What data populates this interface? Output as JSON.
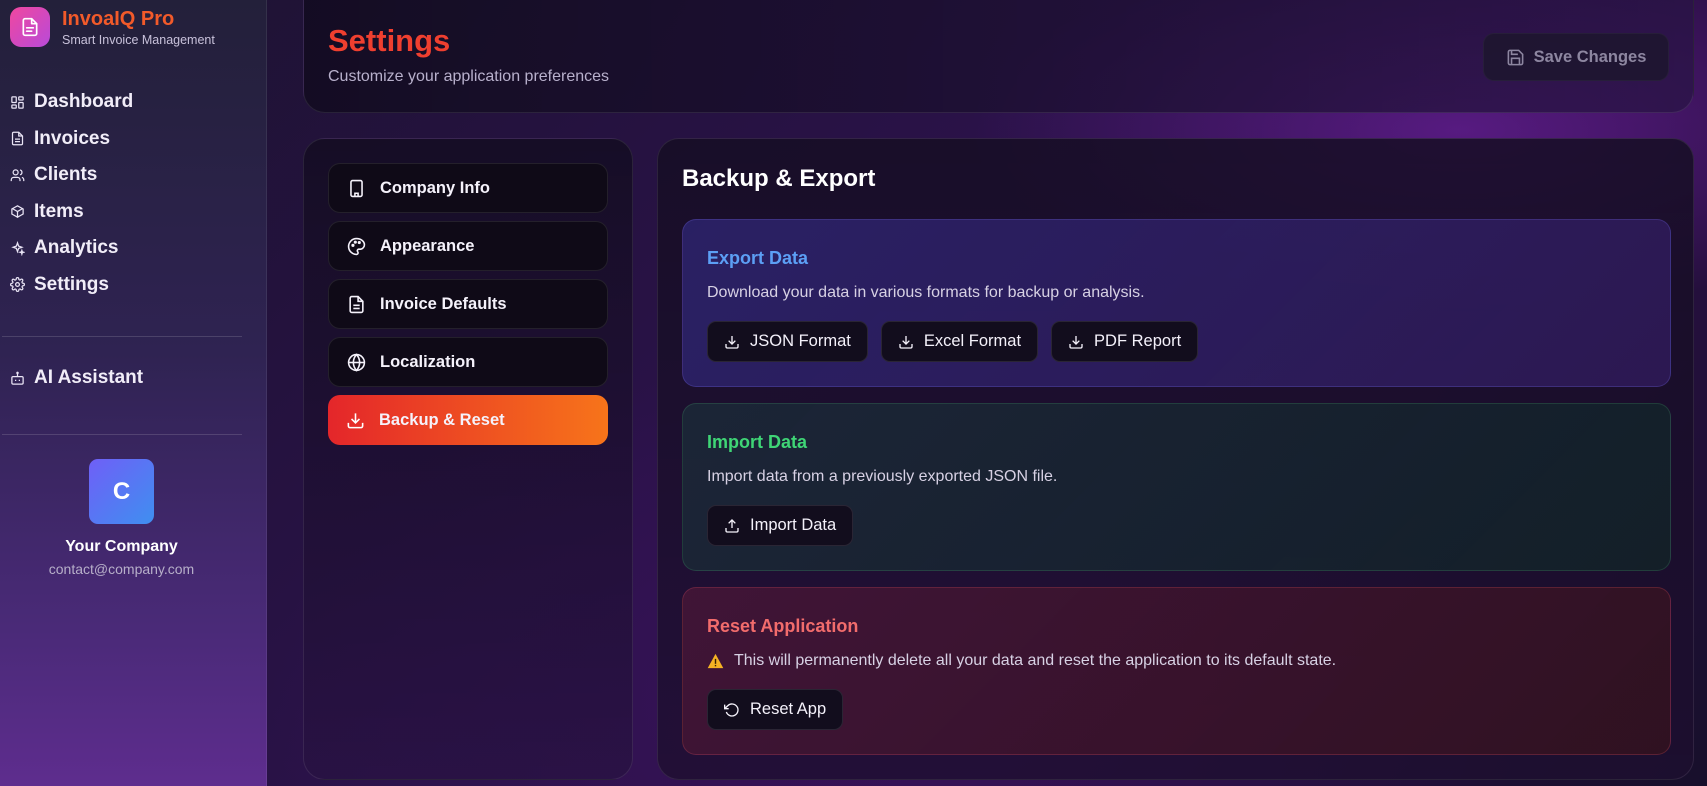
{
  "brand": {
    "title": "InvoaIQ Pro",
    "subtitle": "Smart Invoice Management"
  },
  "nav": {
    "items": [
      {
        "label": "Dashboard",
        "icon": "grid-icon"
      },
      {
        "label": "Invoices",
        "icon": "file-icon"
      },
      {
        "label": "Clients",
        "icon": "users-icon"
      },
      {
        "label": "Items",
        "icon": "box-icon"
      },
      {
        "label": "Analytics",
        "icon": "sparkles-icon"
      },
      {
        "label": "Settings",
        "icon": "gear-icon"
      }
    ],
    "assistant_label": "AI Assistant"
  },
  "profile": {
    "avatar_letter": "C",
    "name": "Your Company",
    "email": "contact@company.com"
  },
  "header": {
    "title": "Settings",
    "subtitle": "Customize your application preferences",
    "save_label": "Save Changes"
  },
  "tabs": [
    {
      "label": "Company Info",
      "icon": "building-icon"
    },
    {
      "label": "Appearance",
      "icon": "palette-icon"
    },
    {
      "label": "Invoice Defaults",
      "icon": "document-icon"
    },
    {
      "label": "Localization",
      "icon": "globe-icon"
    },
    {
      "label": "Backup & Reset",
      "icon": "download-icon",
      "active": true
    }
  ],
  "content": {
    "title": "Backup & Export",
    "export": {
      "title": "Export Data",
      "description": "Download your data in various formats for backup or analysis.",
      "buttons": [
        "JSON Format",
        "Excel Format",
        "PDF Report"
      ]
    },
    "import": {
      "title": "Import Data",
      "description": "Import data from a previously exported JSON file.",
      "button": "Import Data"
    },
    "reset": {
      "title": "Reset Application",
      "description": "This will permanently delete all your data and reset the application to its default state.",
      "button": "Reset App"
    }
  },
  "colors": {
    "brand_accent": "#f25a2a",
    "title_accent": "#ef3f2f",
    "active_tab_start": "#e4262a",
    "active_tab_end": "#f7741a",
    "export_title": "#5c9ff5",
    "import_title": "#3fd576",
    "reset_title": "#f26c6c"
  }
}
